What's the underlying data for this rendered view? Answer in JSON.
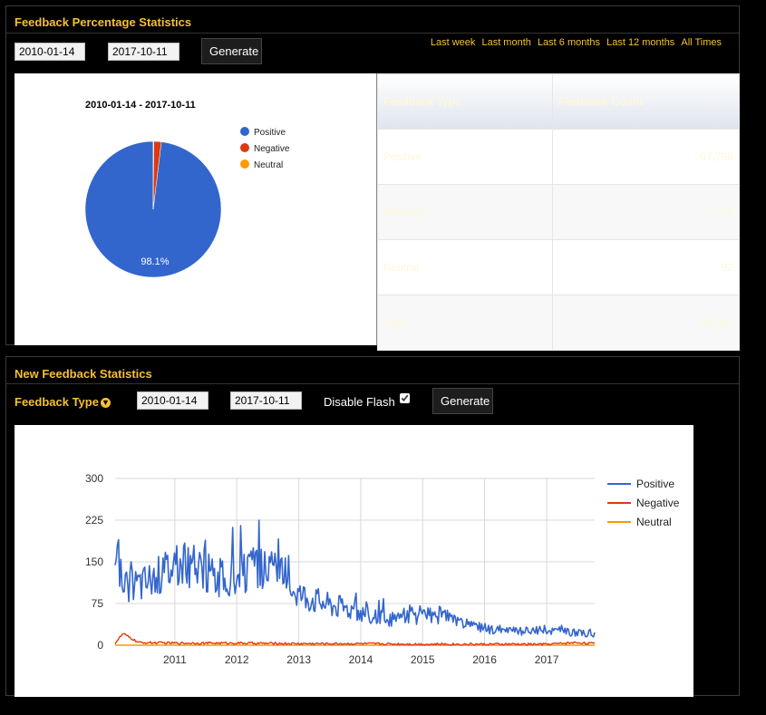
{
  "percentage_section": {
    "title": "Feedback Percentage Statistics",
    "start_date": "2010-01-14",
    "end_date": "2017-10-11",
    "generate_label": "Generate",
    "range_links": [
      "Last week",
      "Last month",
      "Last 6 months",
      "Last 12 months",
      "All Times"
    ],
    "table": {
      "headers": [
        "Feedback Type",
        "Feedback Count"
      ],
      "rows": [
        {
          "type": "Positive",
          "count": "67,766"
        },
        {
          "type": "Negative",
          "count": "1,226"
        },
        {
          "type": "Neutral",
          "count": "92"
        },
        {
          "type": "Total",
          "count": "69,084"
        }
      ]
    }
  },
  "new_section": {
    "title": "New Feedback Statistics",
    "feedback_type_label": "Feedback Type",
    "start_date": "2010-01-14",
    "end_date": "2017-10-11",
    "disable_flash_label": "Disable Flash",
    "disable_flash_checked": true,
    "generate_label": "Generate"
  },
  "colors": {
    "accent": "#f6c033",
    "positive": "#3366cc",
    "negative": "#dc3912",
    "neutral": "#ff9900"
  },
  "chart_data": [
    {
      "type": "pie",
      "title": "2010-01-14 - 2017-10-11",
      "series": [
        {
          "name": "Positive",
          "value": 67766
        },
        {
          "name": "Negative",
          "value": 1226
        },
        {
          "name": "Neutral",
          "value": 92
        }
      ],
      "slice_labels": [
        "98.1%"
      ],
      "legend": "right"
    },
    {
      "type": "line",
      "title": "",
      "x_ticks": [
        "2011",
        "2012",
        "2013",
        "2014",
        "2015",
        "2016",
        "2017"
      ],
      "xlim": [
        "2010-01-14",
        "2017-10-11"
      ],
      "y_ticks": [
        "0",
        "75",
        "150",
        "225",
        "300"
      ],
      "ylim": [
        0,
        300
      ],
      "grid": true,
      "legend": "right",
      "series": [
        {
          "name": "Positive",
          "x": [
            "2010-01-14",
            "2010-04",
            "2010-07",
            "2010-10",
            "2011-01",
            "2011-04",
            "2011-07",
            "2011-10",
            "2012-01",
            "2012-04",
            "2012-07",
            "2012-10",
            "2013-01",
            "2013-04",
            "2013-07",
            "2013-10",
            "2014-01",
            "2014-04",
            "2014-07",
            "2014-10",
            "2015-01",
            "2015-04",
            "2015-07",
            "2015-10",
            "2016-01",
            "2016-04",
            "2016-07",
            "2016-10",
            "2017-01",
            "2017-04",
            "2017-07",
            "2017-10-11"
          ],
          "values": [
            160,
            110,
            115,
            130,
            150,
            145,
            135,
            120,
            120,
            135,
            140,
            130,
            95,
            85,
            75,
            70,
            60,
            50,
            45,
            55,
            50,
            55,
            45,
            35,
            30,
            28,
            25,
            25,
            28,
            25,
            22,
            20
          ]
        },
        {
          "name": "Negative",
          "x": [
            "2010-01-14",
            "2010-03",
            "2010-06",
            "2011-01",
            "2012-01",
            "2013-01",
            "2014-01",
            "2015-01",
            "2016-01",
            "2017-01",
            "2017-07",
            "2017-10-11"
          ],
          "values": [
            3,
            20,
            4,
            3,
            3,
            2,
            2,
            1,
            1,
            1,
            4,
            2
          ]
        },
        {
          "name": "Neutral",
          "x": [
            "2010-01-14",
            "2013-01",
            "2017-10-11"
          ],
          "values": [
            0,
            0,
            0
          ]
        }
      ]
    }
  ]
}
